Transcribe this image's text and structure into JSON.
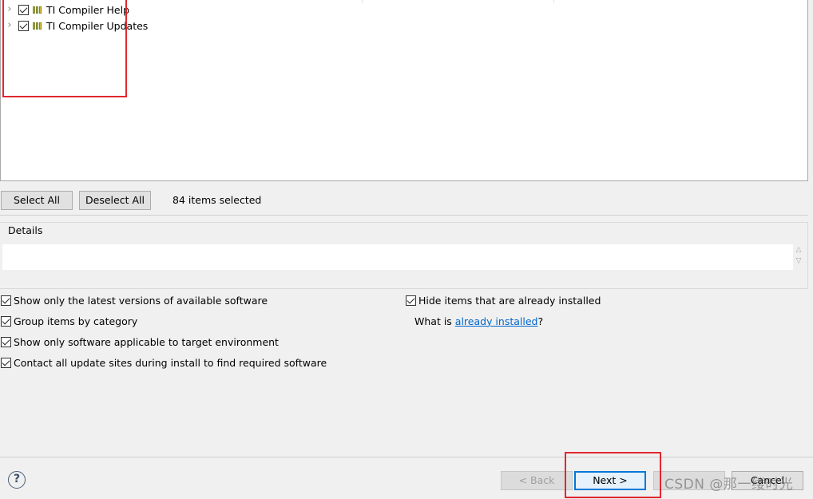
{
  "tree": {
    "items": [
      {
        "label": "TI Compiler Help",
        "checked": true,
        "icon": "feature-icon"
      },
      {
        "label": "TI Compiler Updates",
        "checked": true,
        "icon": "feature-icon"
      }
    ]
  },
  "selection": {
    "select_all_label": "Select All",
    "deselect_all_label": "Deselect All",
    "count_text": "84 items selected"
  },
  "details": {
    "group_label": "Details",
    "text": ""
  },
  "options": {
    "latest_versions": {
      "label": "Show only the latest versions of available software",
      "checked": true
    },
    "group_by_category": {
      "label": "Group items by category",
      "checked": true
    },
    "target_environment": {
      "label": "Show only software applicable to target environment",
      "checked": true
    },
    "contact_update_sites": {
      "label": "Contact all update sites during install to find required software",
      "checked": true
    },
    "hide_installed": {
      "label": "Hide items that are already installed",
      "checked": true
    },
    "what_is_prefix": "What is ",
    "what_is_link": "already installed",
    "what_is_suffix": "?"
  },
  "footer": {
    "help_icon": "?",
    "back_label": "< Back",
    "next_label": "Next >",
    "cancel_label": "Cancel"
  },
  "watermark": "CSDN @那一缕时光",
  "colors": {
    "highlight": "#e0282f",
    "link": "#0066cc",
    "primary_border": "#0078d7"
  }
}
